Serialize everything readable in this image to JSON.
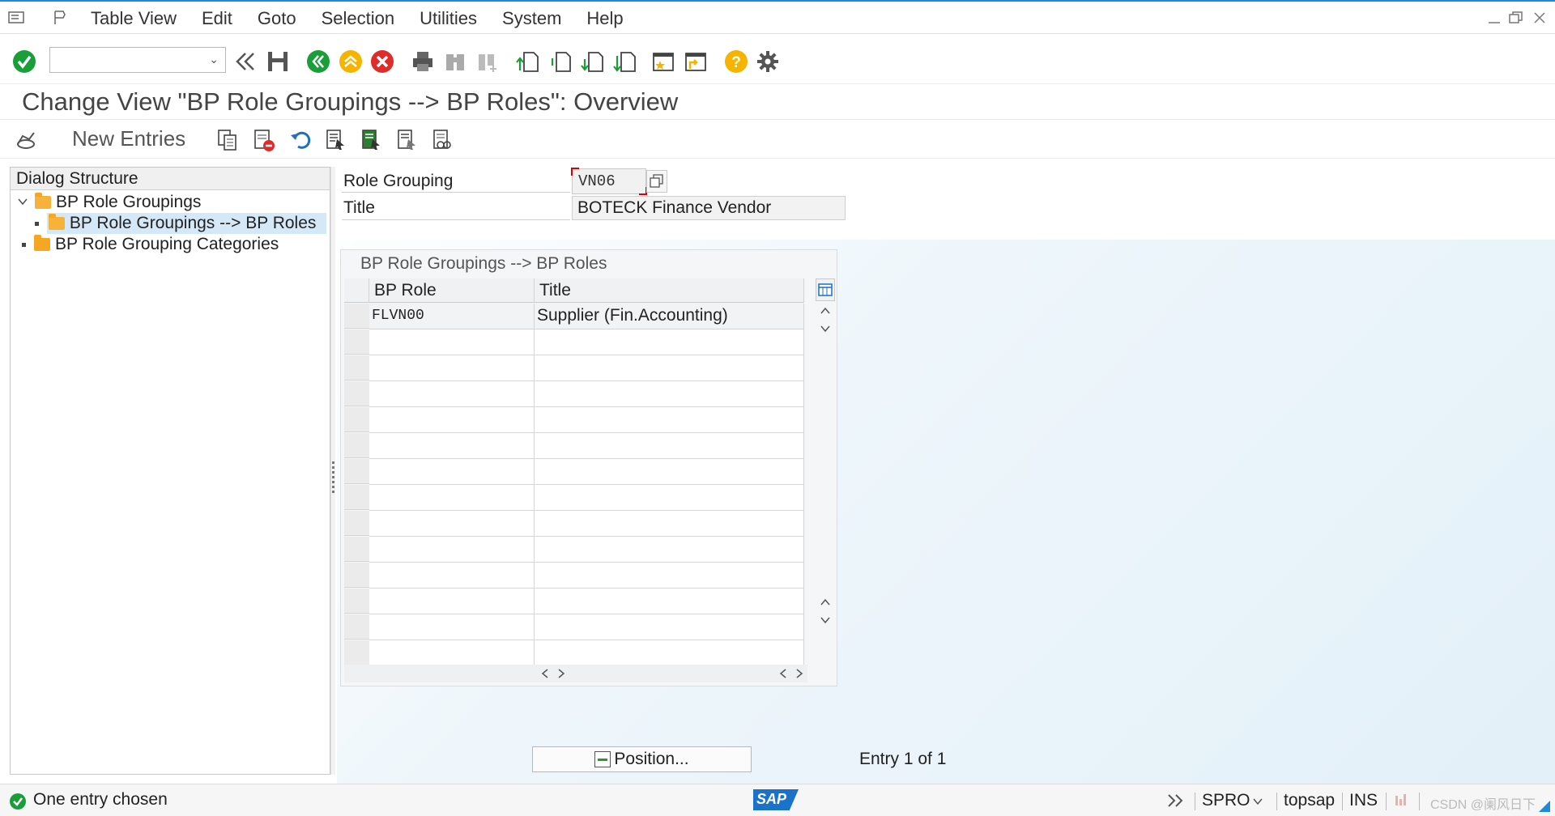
{
  "menubar": {
    "items": [
      "Table View",
      "Edit",
      "Goto",
      "Selection",
      "Utilities",
      "System",
      "Help"
    ]
  },
  "toolbar": {
    "command_value": ""
  },
  "page": {
    "title": "Change View \"BP Role Groupings --> BP Roles\": Overview"
  },
  "app_toolbar": {
    "new_entries": "New Entries"
  },
  "dialog_structure": {
    "header": "Dialog Structure",
    "items": [
      {
        "label": "BP Role Groupings",
        "level": 0,
        "expanded": true
      },
      {
        "label": "BP Role Groupings --> BP Roles",
        "level": 1,
        "selected": true
      },
      {
        "label": "BP Role Grouping Categories",
        "level": 0
      }
    ]
  },
  "header_form": {
    "role_grouping_label": "Role Grouping",
    "role_grouping_value": "VN06",
    "title_label": "Title",
    "title_value": "BOTECK Finance Vendor"
  },
  "table": {
    "caption": "BP Role Groupings --> BP Roles",
    "columns": [
      "BP Role",
      "Title"
    ],
    "rows": [
      {
        "bp_role": "FLVN00",
        "title": "Supplier (Fin.Accounting)"
      }
    ],
    "empty_rows": 13
  },
  "footer": {
    "position_button": "Position...",
    "entry_info": "Entry 1 of 1"
  },
  "statusbar": {
    "message": "One entry chosen",
    "logo": "SAP",
    "transaction": "SPRO",
    "server": "topsap",
    "mode": "INS",
    "watermark": "CSDN @阑风日下"
  },
  "colors": {
    "accent_blue": "#1f8ad8",
    "ok_green": "#1a9e3a",
    "cancel_red": "#e02b2b",
    "folder_yellow": "#f5a623",
    "help_orange": "#f4b400"
  }
}
